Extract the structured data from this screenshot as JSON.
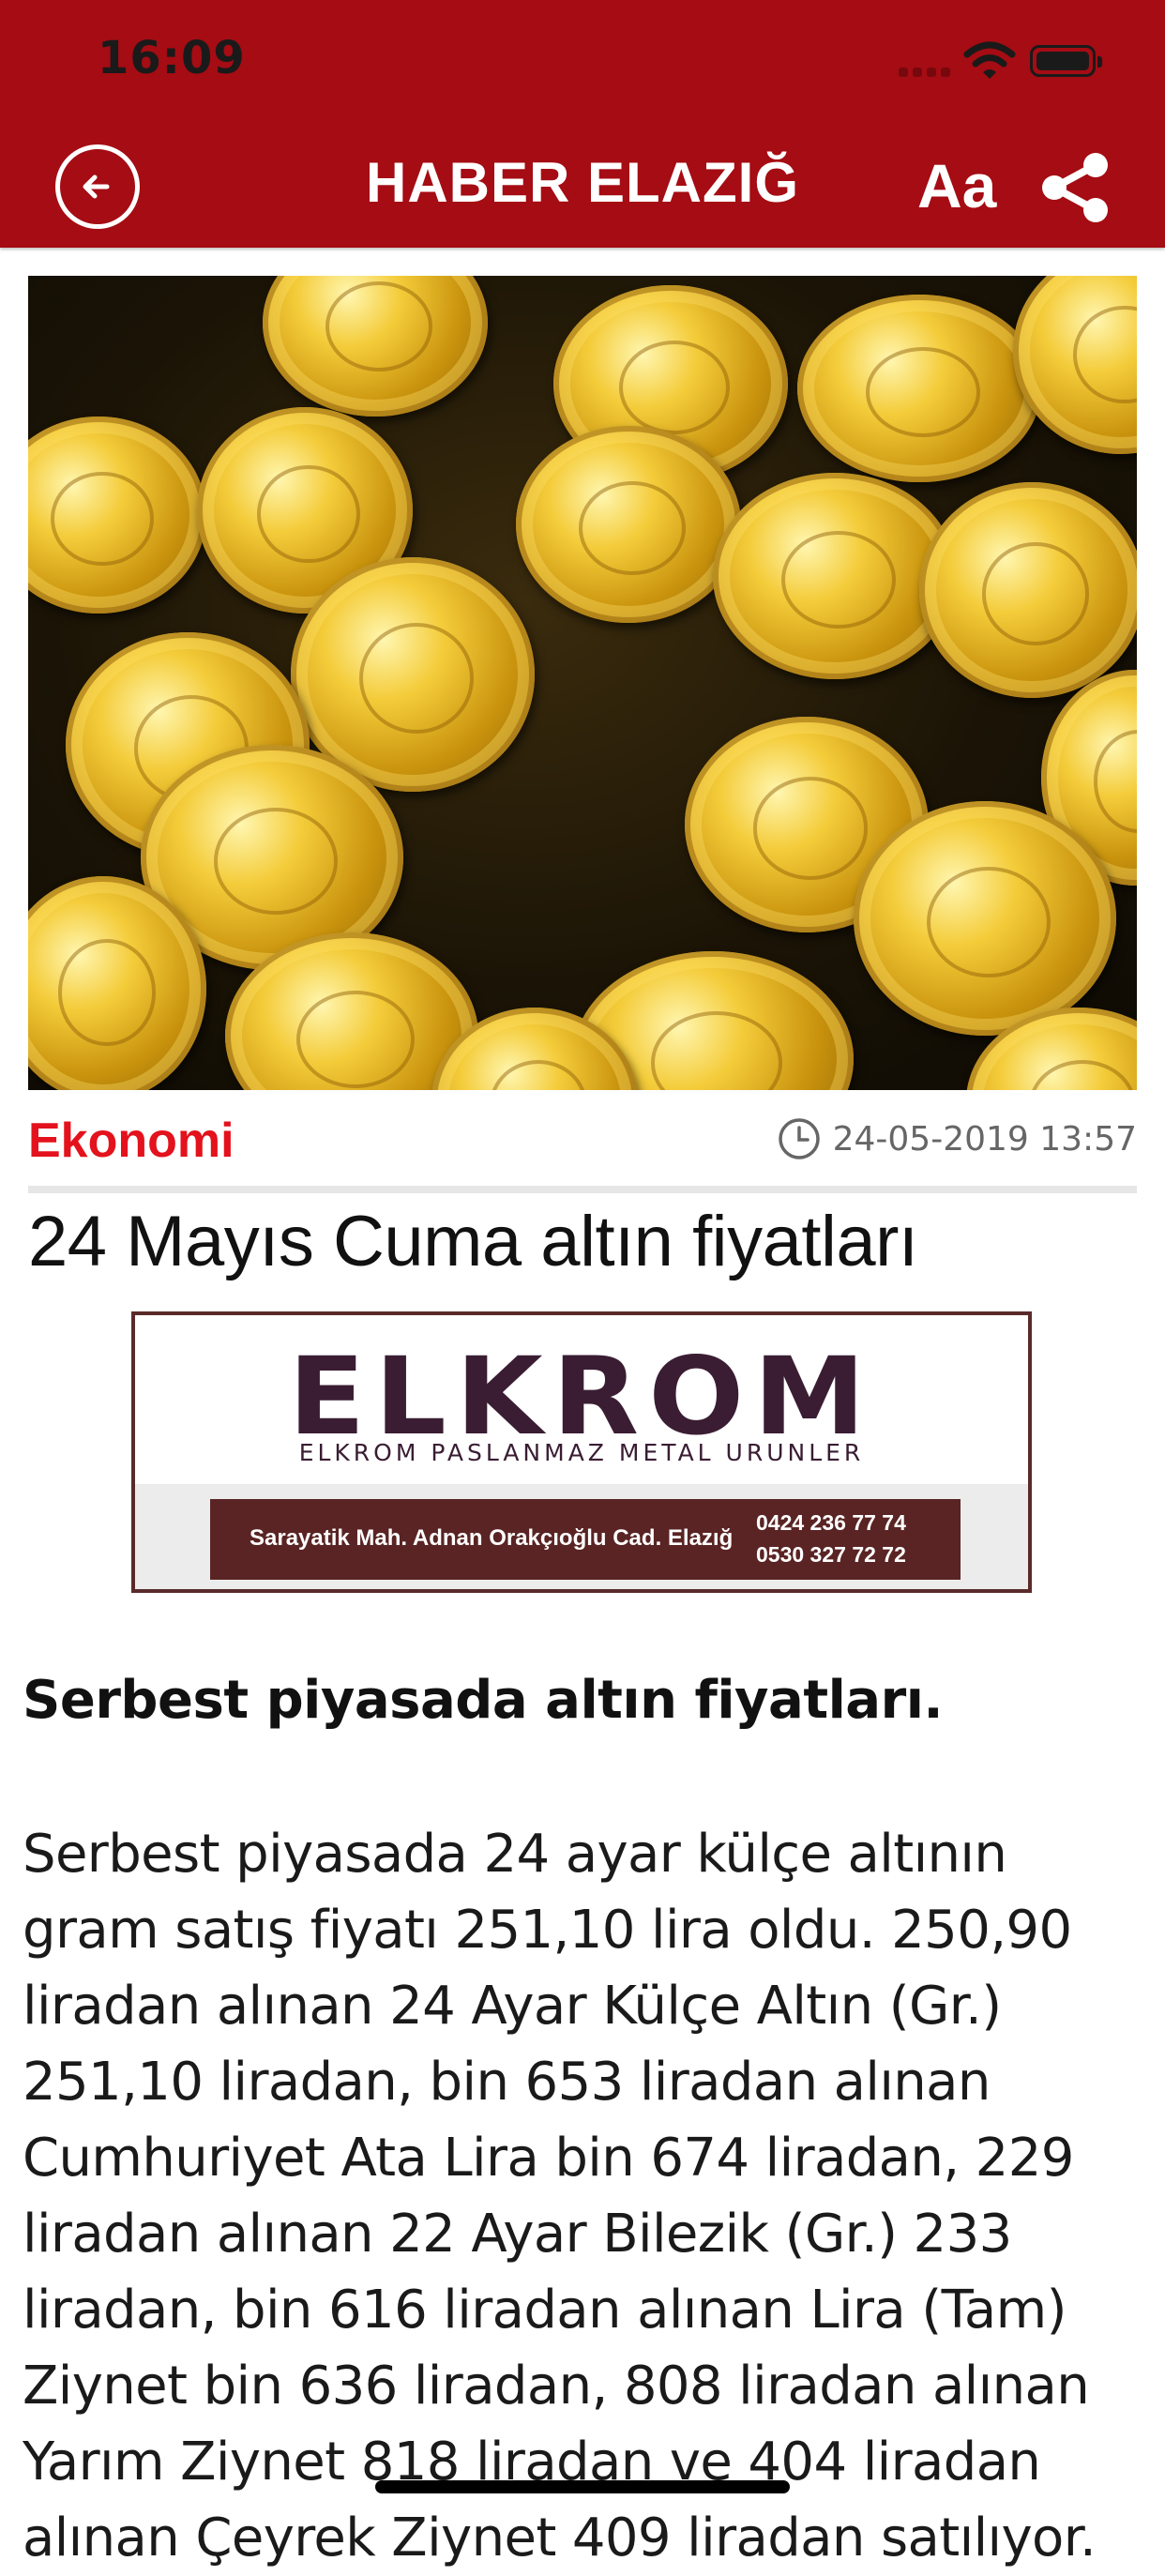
{
  "status_bar": {
    "time": "16:09"
  },
  "header": {
    "title": "HABER ELAZIĞ",
    "font_button_label": "Aa",
    "background_color": "#a50c13",
    "icons": {
      "back": "back-arrow-circle-icon",
      "share": "share-icon"
    }
  },
  "article": {
    "image": "gold-coins-photo",
    "category": "Ekonomi",
    "category_color": "#e3121c",
    "date": "24-05-2019 13:57",
    "title": "24 Mayıs Cuma altın fiyatları",
    "lead": "Serbest piyasada altın fiyatları.",
    "body": "Serbest piyasada 24 ayar külçe altının gram satış fiyatı 251,10 lira oldu. 250,90 liradan alınan 24 Ayar Külçe Altın (Gr.) 251,10 liradan, bin 653 liradan alınan Cumhuriyet Ata Lira bin 674 liradan, 229 liradan alınan 22 Ayar Bilezik (Gr.) 233 liradan, bin 616 liradan alınan Lira (Tam) Ziynet bin 636 liradan, 808 liradan alınan Yarım Ziynet 818 liradan ve 404 liradan alınan Çeyrek Ziynet 409 liradan satılıyor."
  },
  "ad": {
    "brand": "ELKROM",
    "subtitle": "ELKROM PASLANMAZ METAL URUNLER",
    "address": "Sarayatik Mah. Adnan Orakçıoğlu Cad. Elazığ",
    "phone_1": "0424 236 77 74",
    "phone_2": "0530 327 72 72"
  }
}
